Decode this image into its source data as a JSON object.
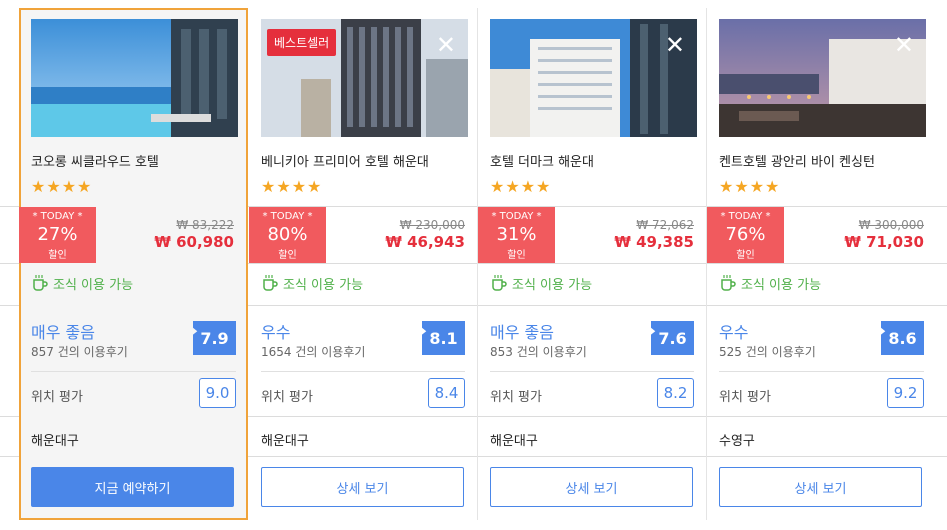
{
  "hotels": [
    {
      "name": "코오롱 씨클라우드 호텔",
      "stars": "★★★★",
      "today": "* TODAY *",
      "discount": "27%",
      "discount_label": "할인",
      "old_price": "₩ 83,222",
      "price": "₩ 60,980",
      "breakfast": "조식 이용 가능",
      "review_label": "매우 좋음",
      "review_count": "857 건의 이용후기",
      "score": "7.9",
      "location_label": "위치 평가",
      "location_score": "9.0",
      "district": "해운대구",
      "button": "지금 예약하기"
    },
    {
      "badge": "베스트셀러",
      "close": "✕",
      "name": "베니키아 프리미어 호텔 해운대",
      "stars": "★★★★",
      "today": "* TODAY *",
      "discount": "80%",
      "discount_label": "할인",
      "old_price": "₩ 230,000",
      "price": "₩ 46,943",
      "breakfast": "조식 이용 가능",
      "review_label": "우수",
      "review_count": "1654 건의 이용후기",
      "score": "8.1",
      "location_label": "위치 평가",
      "location_score": "8.4",
      "district": "해운대구",
      "button": "상세 보기"
    },
    {
      "close": "✕",
      "name": "호텔 더마크 해운대",
      "stars": "★★★★",
      "today": "* TODAY *",
      "discount": "31%",
      "discount_label": "할인",
      "old_price": "₩ 72,062",
      "price": "₩ 49,385",
      "breakfast": "조식 이용 가능",
      "review_label": "매우 좋음",
      "review_count": "853 건의 이용후기",
      "score": "7.6",
      "location_label": "위치 평가",
      "location_score": "8.2",
      "district": "해운대구",
      "button": "상세 보기"
    },
    {
      "close": "✕",
      "name": "켄트호텔 광안리 바이 켄싱턴",
      "stars": "★★★★",
      "today": "* TODAY *",
      "discount": "76%",
      "discount_label": "할인",
      "old_price": "₩ 300,000",
      "price": "₩ 71,030",
      "breakfast": "조식 이용 가능",
      "review_label": "우수",
      "review_count": "525 건의 이용후기",
      "score": "8.6",
      "location_label": "위치 평가",
      "location_score": "9.2",
      "district": "수영구",
      "button": "상세 보기"
    }
  ],
  "colors": {
    "accent": "#4a86e8",
    "discount": "#f15a5e",
    "price": "#e52f3c",
    "breakfast": "#50b04a",
    "selected_border": "#f0a33a",
    "star": "#f5a623"
  }
}
